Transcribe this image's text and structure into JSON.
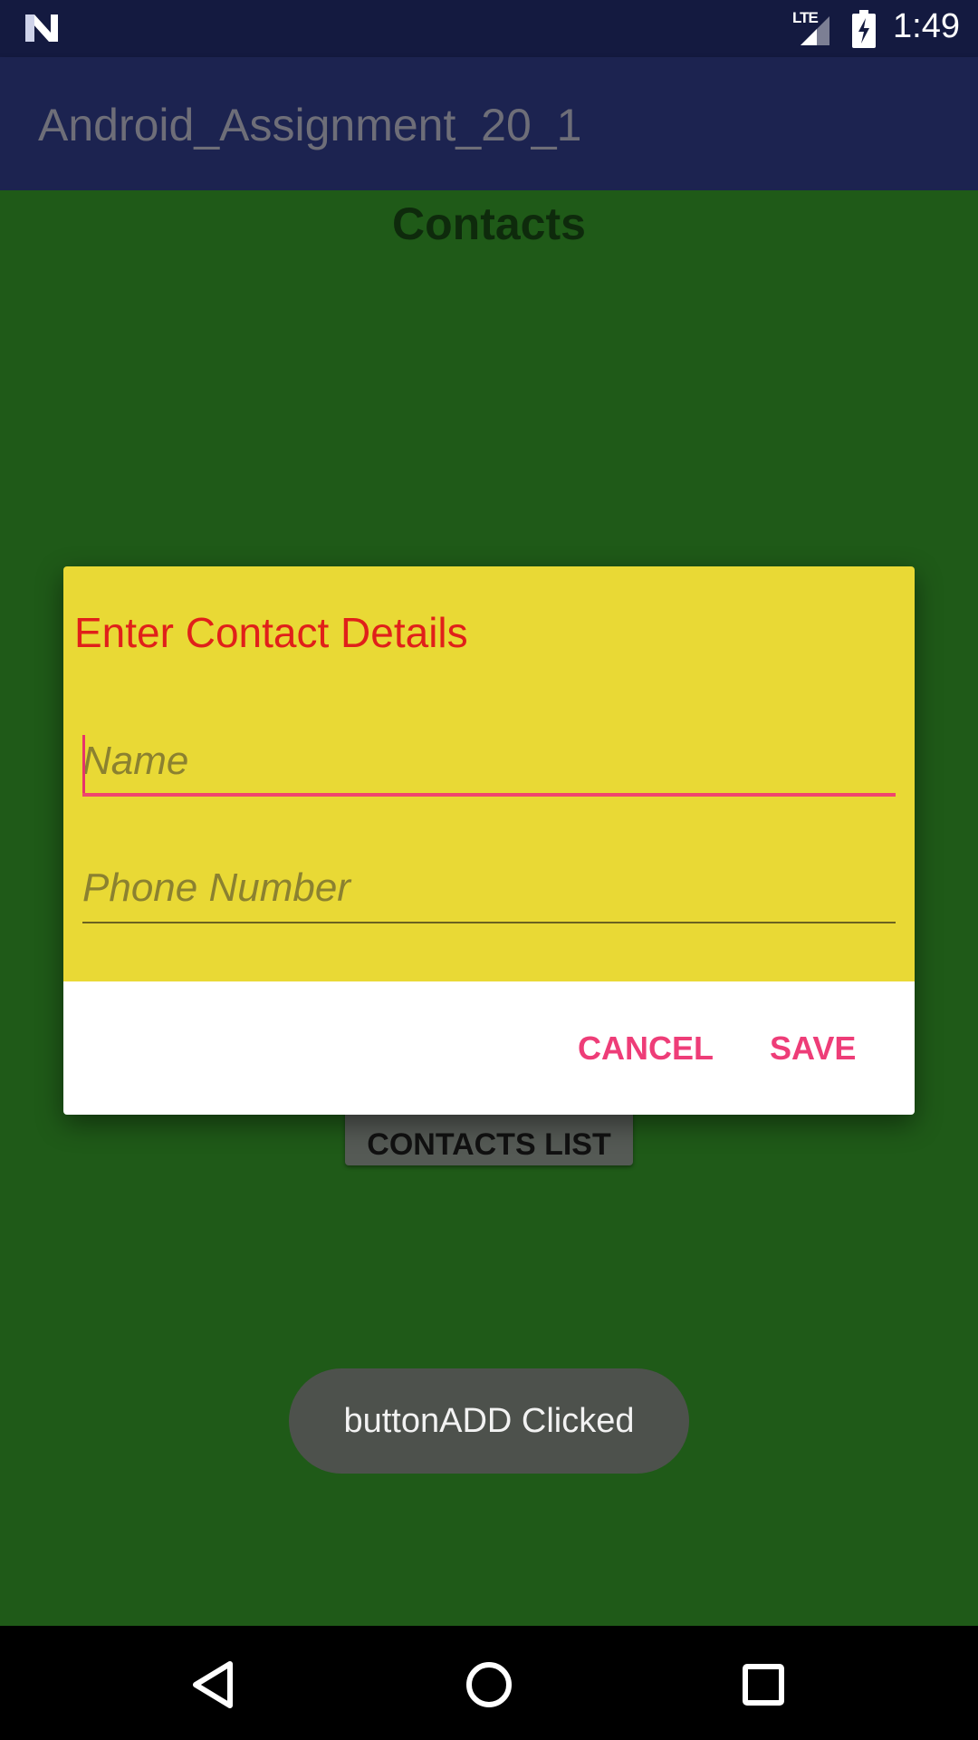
{
  "status_bar": {
    "time": "1:49",
    "network_label": "LTE",
    "icons": [
      "n-logo-icon",
      "signal-icon",
      "battery-charging-icon"
    ]
  },
  "app_bar": {
    "title": "Android_Assignment_20_1"
  },
  "content": {
    "heading": "Contacts",
    "contacts_list_button": "CONTACTS LIST"
  },
  "dialog": {
    "title": "Enter Contact Details",
    "name_placeholder": "Name",
    "phone_placeholder": "Phone Number",
    "cancel_label": "CANCEL",
    "save_label": "SAVE",
    "colors": {
      "body": "#e9d935",
      "title": "#e0201a",
      "accent": "#ee3d78"
    }
  },
  "toast": {
    "message": "buttonADD Clicked"
  },
  "nav_bar": {
    "icons": [
      "back-icon",
      "home-icon",
      "recent-apps-icon"
    ]
  }
}
